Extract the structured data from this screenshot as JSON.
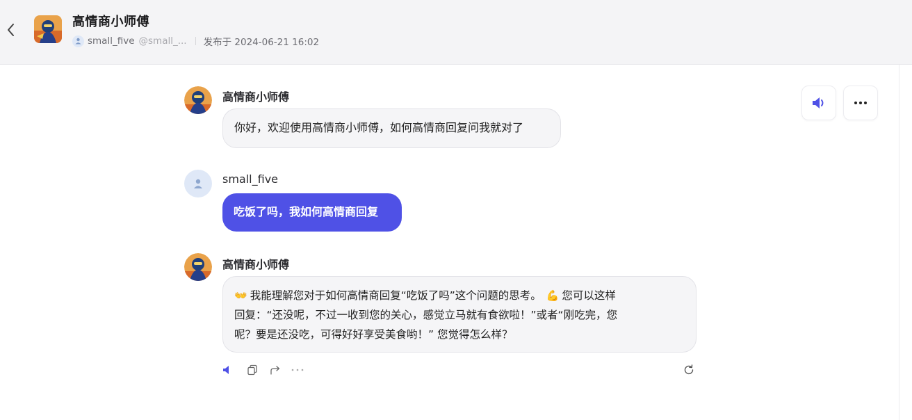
{
  "header": {
    "bot_name": "高情商小师傅",
    "author_name": "small_five",
    "author_handle": "@small_...",
    "published": "发布于 2024-06-21 16:02"
  },
  "messages": [
    {
      "role": "bot",
      "name": "高情商小师傅",
      "text": "你好，欢迎使用高情商小师傅，如何高情商回复问我就对了"
    },
    {
      "role": "user",
      "name": "small_five",
      "text": "吃饭了吗，我如何高情商回复"
    },
    {
      "role": "bot",
      "name": "高情商小师傅",
      "line1": "我能理解您对于如何高情商回复“吃饭了吗”这个问题的思考。",
      "line1b": "您可以这样",
      "line2": "回复：“还没呢，不过一收到您的关心，感觉立马就有食欲啦！”或者“刚吃完，您",
      "line3": "呢？要是还没吃，可得好好享受美食哟！” 您觉得怎么样？",
      "emoji1": "👐",
      "emoji2": "💪"
    }
  ],
  "icons": {
    "back": "chevron-left-icon",
    "speaker": "speaker-icon",
    "more": "more-horizontal-icon",
    "copy": "copy-icon",
    "share": "share-icon",
    "regenerate": "refresh-icon"
  },
  "colors": {
    "accent": "#4f51e6",
    "header_bg": "#f4f4f6",
    "bubble_bot_bg": "#f5f5f7"
  }
}
